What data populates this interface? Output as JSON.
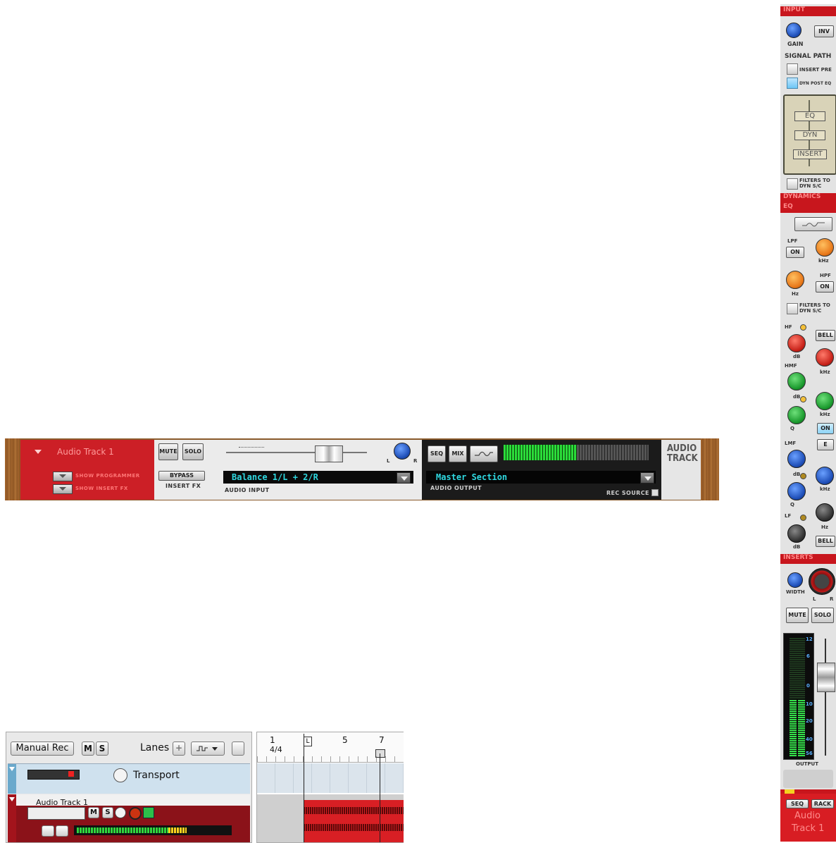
{
  "rack_device": {
    "track_name": "Audio Track 1",
    "show_programmer": "SHOW PROGRAMMER",
    "show_insert_fx": "SHOW INSERT FX",
    "mute": "MUTE",
    "solo": "SOLO",
    "bypass": "BYPASS",
    "insert_fx": "INSERT FX",
    "pan_left": "L",
    "pan_right": "R",
    "audio_input_value": "Balance 1/L + 2/R",
    "audio_input_label": "AUDIO INPUT",
    "seq": "SEQ",
    "mix": "MIX",
    "audio_output_value": "Master Section",
    "audio_output_label": "AUDIO OUTPUT",
    "rec_source": "REC SOURCE",
    "plate_line1": "AUDIO",
    "plate_line2": "TRACK"
  },
  "sequencer": {
    "manual_rec": "Manual Rec",
    "m": "M",
    "s": "S",
    "lanes": "Lanes",
    "transport_label": "Transport",
    "audio_track_label": "Audio Track 1",
    "ruler": {
      "bar1": "1",
      "signature": "4/4",
      "loop_left": "L",
      "bar5": "5",
      "bar7": "7"
    }
  },
  "channel_strip": {
    "input_header": "INPUT",
    "inv": "INV",
    "gain": "GAIN",
    "signal_path": "SIGNAL PATH",
    "insert_pre": "INSERT PRE",
    "dyn_post_eq": "DYN POST EQ",
    "path_eq": "EQ",
    "path_dyn": "DYN",
    "path_insert": "INSERT",
    "filters_to_dyn_sc_1": "FILTERS TO DYN S/C",
    "dynamics_header": "DYNAMICS",
    "eq_header": "EQ",
    "lpf": "LPF",
    "lpf_on": "ON",
    "khz": "kHz",
    "hz": "Hz",
    "hpf": "HPF",
    "hpf_on": "ON",
    "filters_to_dyn_sc_2": "FILTERS TO DYN S/C",
    "hf": "HF",
    "bell": "BELL",
    "db": "dB",
    "hmf": "HMF",
    "q": "Q",
    "on_button": "ON",
    "lmf": "LMF",
    "e_button": "E",
    "lf": "LF",
    "bell2": "BELL",
    "inserts_header": "INSERTS",
    "width": "WIDTH",
    "l": "L",
    "r": "R",
    "mute": "MUTE",
    "solo": "SOLO",
    "meter_scale": [
      "12",
      "6",
      "0",
      "10",
      "20",
      "40",
      "56"
    ],
    "output": "OUTPUT",
    "seq": "SEQ",
    "rack": "RACK",
    "track_name_line1": "Audio",
    "track_name_line2": "Track 1"
  }
}
